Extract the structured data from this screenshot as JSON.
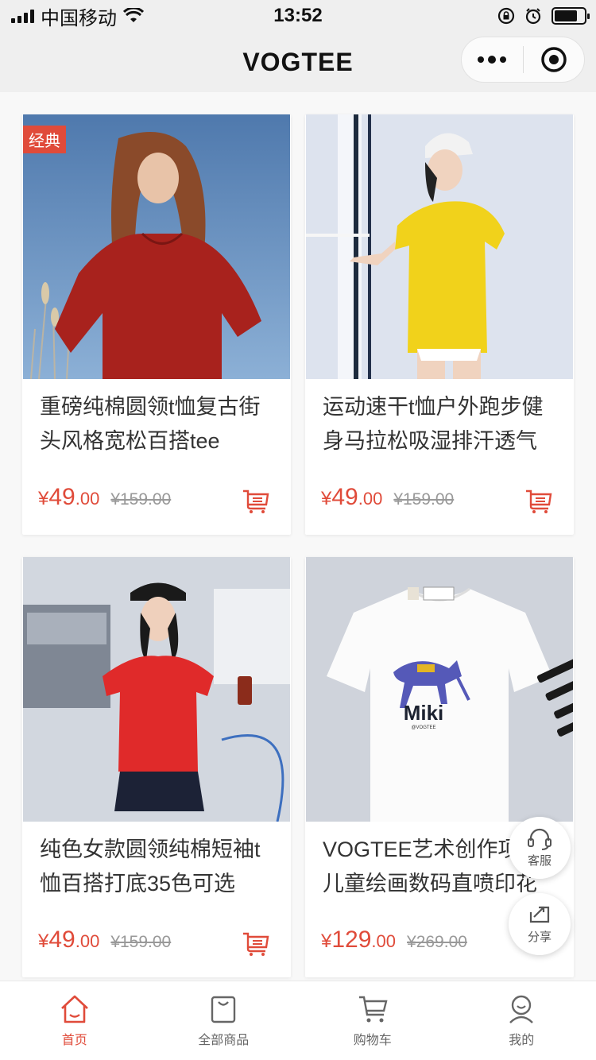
{
  "status_bar": {
    "carrier": "中国移动",
    "time": "13:52"
  },
  "nav": {
    "title": "VOGTEE"
  },
  "products": [
    {
      "tag": "经典",
      "title": "重磅纯棉圆领t恤复古街头风格宽松百搭tee",
      "price_int": "49",
      "price_dec": ".00",
      "currency": "¥",
      "original_price": "¥159.00",
      "image": "man-red-tshirt"
    },
    {
      "tag": "",
      "title": "运动速干t恤户外跑步健身马拉松吸湿排汗透气",
      "price_int": "49",
      "price_dec": ".00",
      "currency": "¥",
      "original_price": "¥159.00",
      "image": "woman-yellow-tshirt"
    },
    {
      "tag": "",
      "title": "纯色女款圆领纯棉短袖t恤百搭打底35色可选",
      "price_int": "49",
      "price_dec": ".00",
      "currency": "¥",
      "original_price": "¥159.00",
      "image": "woman-red-tshirt"
    },
    {
      "tag": "",
      "title": "VOGTEE艺术创作项目儿童绘画数码直喷印花",
      "price_int": "129",
      "price_dec": ".00",
      "currency": "¥",
      "original_price": "¥269.00",
      "image": "white-tshirt-miki",
      "print_text": "Miki",
      "print_sub": "@VOGTEE"
    }
  ],
  "float_buttons": {
    "service": "客服",
    "share": "分享"
  },
  "tabs": [
    {
      "label": "首页",
      "icon": "home-icon",
      "active": true
    },
    {
      "label": "全部商品",
      "icon": "bag-icon",
      "active": false
    },
    {
      "label": "购物车",
      "icon": "cart-icon",
      "active": false
    },
    {
      "label": "我的",
      "icon": "user-icon",
      "active": false
    }
  ],
  "colors": {
    "accent": "#e04b3a",
    "tab_inactive": "#666666"
  }
}
